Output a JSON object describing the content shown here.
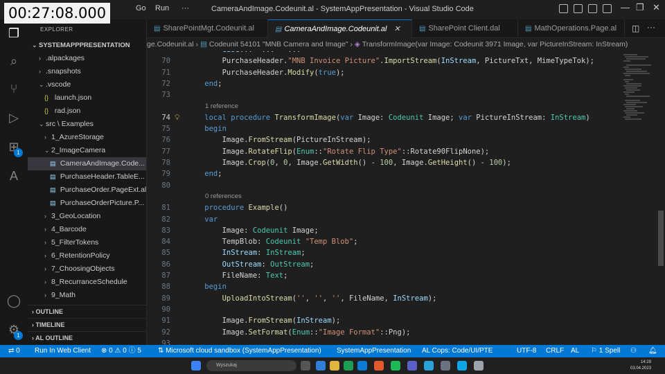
{
  "overlay": {
    "timestamp": "00:27:08.000"
  },
  "titlebar": {
    "menus": [
      "Go",
      "Run",
      "···"
    ],
    "title": "CameraAndImage.Codeunit.al - SystemAppPresentation - Visual Studio Code"
  },
  "activity": {
    "badges": [
      "1",
      "1"
    ]
  },
  "sidebar": {
    "title": "EXPLORER",
    "workspace": "SYSTEMAPPPRESENTATION",
    "items": [
      {
        "label": ".alpackages",
        "kind": "folder",
        "indent": 1,
        "expanded": false
      },
      {
        "label": ".snapshots",
        "kind": "folder",
        "indent": 1,
        "expanded": false
      },
      {
        "label": ".vscode",
        "kind": "folder",
        "indent": 1,
        "expanded": true
      },
      {
        "label": "launch.json",
        "kind": "json",
        "indent": 2
      },
      {
        "label": "rad.json",
        "kind": "json",
        "indent": 2
      },
      {
        "label": "src \\ Examples",
        "kind": "folder",
        "indent": 1,
        "expanded": true
      },
      {
        "label": "1_AzureStorage",
        "kind": "folder",
        "indent": 2,
        "expanded": false
      },
      {
        "label": "2_ImageCamera",
        "kind": "folder",
        "indent": 2,
        "expanded": true
      },
      {
        "label": "CameraAndImage.Code...",
        "kind": "al",
        "indent": 3,
        "selected": true
      },
      {
        "label": "PurchaseHeader.TableE...",
        "kind": "al",
        "indent": 3
      },
      {
        "label": "PurchaseOrder.PageExt.al",
        "kind": "al",
        "indent": 3
      },
      {
        "label": "PurchaseOrderPicture.P...",
        "kind": "al",
        "indent": 3
      },
      {
        "label": "3_GeoLocation",
        "kind": "folder",
        "indent": 2,
        "expanded": false
      },
      {
        "label": "4_Barcode",
        "kind": "folder",
        "indent": 2,
        "expanded": false
      },
      {
        "label": "5_FilterTokens",
        "kind": "folder",
        "indent": 2,
        "expanded": false
      },
      {
        "label": "6_RetentionPolicy",
        "kind": "folder",
        "indent": 2,
        "expanded": false
      },
      {
        "label": "7_ChoosingObjects",
        "kind": "folder",
        "indent": 2,
        "expanded": false
      },
      {
        "label": "8_RecurranceSchedule",
        "kind": "folder",
        "indent": 2,
        "expanded": false
      },
      {
        "label": "9_Math",
        "kind": "folder",
        "indent": 2,
        "expanded": false
      }
    ],
    "sections": [
      "OUTLINE",
      "TIMELINE",
      "AL OUTLINE"
    ]
  },
  "tabs": [
    {
      "label": "SharePointMgt.Codeunit.al",
      "active": false
    },
    {
      "label": "CameraAndImage.Codeunit.al",
      "active": true
    },
    {
      "label": "SharePoint Client.dal",
      "active": false
    },
    {
      "label": "MathOperations.Page.al",
      "active": false
    }
  ],
  "breadcrumb": {
    "file": "ge.Codeunit.al",
    "object": "Codeunit 54101 \"MNB Camera and Image\"",
    "method": "TransformImage(var Image: Codeunit 3971 Image, var PictureInStream: InStream)"
  },
  "editor": {
    "current_line": "74",
    "lines": [
      {
        "n": "",
        "tokens": [
          [
            "pl",
            "        "
          ],
          [
            "id",
            "Case"
          ],
          [
            "pl",
            "... \"... \" ..."
          ]
        ]
      },
      {
        "n": "70",
        "tokens": [
          [
            "pl",
            "        PurchaseHeader."
          ],
          [
            "st",
            "\"MNB Invoice Picture\""
          ],
          [
            "pl",
            "."
          ],
          [
            "fn",
            "ImportStream"
          ],
          [
            "pl",
            "("
          ],
          [
            "id",
            "InStream"
          ],
          [
            "pl",
            ", PictureTxt, MimeTypeTok);"
          ]
        ]
      },
      {
        "n": "71",
        "tokens": [
          [
            "pl",
            "        PurchaseHeader."
          ],
          [
            "fn",
            "Modify"
          ],
          [
            "pl",
            "("
          ],
          [
            "kw",
            "true"
          ],
          [
            "pl",
            ");"
          ]
        ]
      },
      {
        "n": "72",
        "tokens": [
          [
            "kw",
            "    end"
          ],
          [
            "pl",
            ";"
          ]
        ]
      },
      {
        "n": "73",
        "tokens": []
      },
      {
        "n": "",
        "lens": "1 reference"
      },
      {
        "n": "74",
        "tokens": [
          [
            "kw",
            "    local procedure "
          ],
          [
            "fn",
            "TransformImage"
          ],
          [
            "pl",
            "("
          ],
          [
            "kw",
            "var "
          ],
          [
            "pl",
            "Image: "
          ],
          [
            "ty",
            "Codeunit"
          ],
          [
            "pl",
            " Image; "
          ],
          [
            "kw",
            "var "
          ],
          [
            "pl",
            "PictureInStream: "
          ],
          [
            "ty",
            "InStream"
          ],
          [
            "pl",
            ")"
          ]
        ]
      },
      {
        "n": "75",
        "tokens": [
          [
            "kw",
            "    begin"
          ]
        ]
      },
      {
        "n": "76",
        "tokens": [
          [
            "pl",
            "        Image."
          ],
          [
            "fn",
            "FromStream"
          ],
          [
            "pl",
            "(PictureInStream);"
          ]
        ]
      },
      {
        "n": "77",
        "tokens": [
          [
            "pl",
            "        Image."
          ],
          [
            "fn",
            "RotateFlip"
          ],
          [
            "pl",
            "("
          ],
          [
            "ty",
            "Enum"
          ],
          [
            "pl",
            "::"
          ],
          [
            "st",
            "\"Rotate Flip Type\""
          ],
          [
            "pl",
            "::Rotate90FlipNone);"
          ]
        ]
      },
      {
        "n": "78",
        "tokens": [
          [
            "pl",
            "        Image."
          ],
          [
            "fn",
            "Crop"
          ],
          [
            "pl",
            "("
          ],
          [
            "num",
            "0"
          ],
          [
            "pl",
            ", "
          ],
          [
            "num",
            "0"
          ],
          [
            "pl",
            ", Image."
          ],
          [
            "fn",
            "GetWidth"
          ],
          [
            "pl",
            "() - "
          ],
          [
            "num",
            "100"
          ],
          [
            "pl",
            ", Image."
          ],
          [
            "fn",
            "GetHeight"
          ],
          [
            "pl",
            "() - "
          ],
          [
            "num",
            "100"
          ],
          [
            "pl",
            ");"
          ]
        ]
      },
      {
        "n": "79",
        "tokens": [
          [
            "kw",
            "    end"
          ],
          [
            "pl",
            ";"
          ]
        ]
      },
      {
        "n": "80",
        "tokens": []
      },
      {
        "n": "",
        "lens": "0 references"
      },
      {
        "n": "81",
        "tokens": [
          [
            "kw",
            "    procedure "
          ],
          [
            "fn",
            "Example"
          ],
          [
            "pl",
            "()"
          ]
        ]
      },
      {
        "n": "82",
        "tokens": [
          [
            "kw",
            "    var"
          ]
        ]
      },
      {
        "n": "83",
        "tokens": [
          [
            "pl",
            "        Image: "
          ],
          [
            "ty",
            "Codeunit"
          ],
          [
            "pl",
            " Image;"
          ]
        ]
      },
      {
        "n": "84",
        "tokens": [
          [
            "pl",
            "        TempBlob: "
          ],
          [
            "ty",
            "Codeunit"
          ],
          [
            "pl",
            " "
          ],
          [
            "st",
            "\"Temp Blob\""
          ],
          [
            "pl",
            ";"
          ]
        ]
      },
      {
        "n": "85",
        "tokens": [
          [
            "id",
            "        InStream"
          ],
          [
            "pl",
            ": "
          ],
          [
            "ty",
            "InStream"
          ],
          [
            "pl",
            ";"
          ]
        ]
      },
      {
        "n": "86",
        "tokens": [
          [
            "id",
            "        OutStream"
          ],
          [
            "pl",
            ": "
          ],
          [
            "ty",
            "OutStream"
          ],
          [
            "pl",
            ";"
          ]
        ]
      },
      {
        "n": "87",
        "tokens": [
          [
            "pl",
            "        FileName: "
          ],
          [
            "ty",
            "Text"
          ],
          [
            "pl",
            ";"
          ]
        ]
      },
      {
        "n": "88",
        "tokens": [
          [
            "kw",
            "    begin"
          ]
        ]
      },
      {
        "n": "89",
        "tokens": [
          [
            "pl",
            "        "
          ],
          [
            "fn",
            "UploadIntoStream"
          ],
          [
            "pl",
            "("
          ],
          [
            "st",
            "''"
          ],
          [
            "pl",
            ", "
          ],
          [
            "st",
            "''"
          ],
          [
            "pl",
            ", "
          ],
          [
            "st",
            "''"
          ],
          [
            "pl",
            ", FileName, "
          ],
          [
            "id",
            "InStream"
          ],
          [
            "pl",
            ");"
          ]
        ]
      },
      {
        "n": "90",
        "tokens": []
      },
      {
        "n": "91",
        "tokens": [
          [
            "pl",
            "        Image."
          ],
          [
            "fn",
            "FromStream"
          ],
          [
            "pl",
            "("
          ],
          [
            "id",
            "InStream"
          ],
          [
            "pl",
            ");"
          ]
        ]
      },
      {
        "n": "92",
        "tokens": [
          [
            "pl",
            "        Image."
          ],
          [
            "fn",
            "SetFormat"
          ],
          [
            "pl",
            "("
          ],
          [
            "ty",
            "Enum"
          ],
          [
            "pl",
            "::"
          ],
          [
            "st",
            "\"Image Format\""
          ],
          [
            "pl",
            "::Png);"
          ]
        ]
      },
      {
        "n": "93",
        "tokens": []
      }
    ]
  },
  "statusbar": {
    "left": [
      "⇄ 0",
      "Run In Web Client",
      "⊗ 0 ⚠ 0 ⓘ 5",
      "⇅ Microsoft cloud sandbox (SystemAppPresentation)",
      "SystemAppPresentation",
      "AL Cops: Code/UI/PTE"
    ],
    "right": [
      "UTF-8",
      "CRLF",
      "AL",
      "⚐ 1 Spell"
    ]
  },
  "taskbar": {
    "search_placeholder": "Wyszukaj",
    "clock_time": "14:28",
    "clock_date": "03.04.2023"
  },
  "colors": {
    "accent": "#0078d4",
    "keyword": "#569cd6",
    "type": "#4ec9b0",
    "string": "#ce9178",
    "function": "#dcdcaa"
  }
}
